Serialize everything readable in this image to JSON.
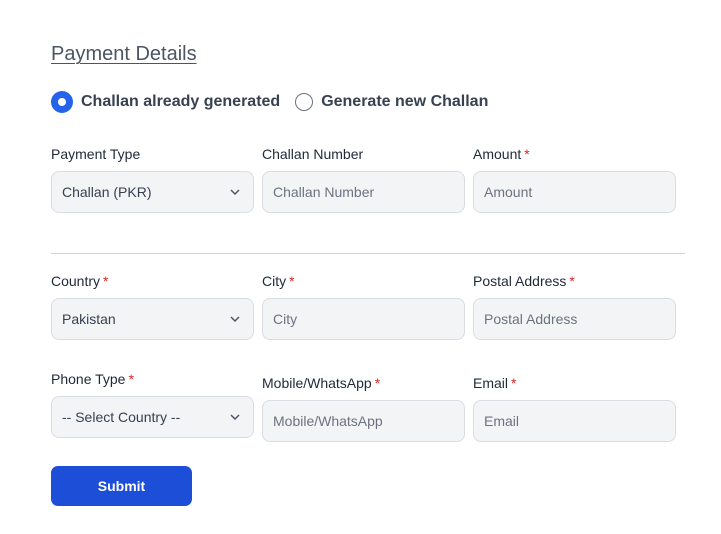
{
  "section_title": "Payment Details",
  "radios": [
    {
      "label": "Challan already generated",
      "checked": true
    },
    {
      "label": "Generate new Challan",
      "checked": false
    }
  ],
  "fields": {
    "payment_type": {
      "label": "Payment Type",
      "required": false,
      "value": "Challan (PKR)"
    },
    "challan_number": {
      "label": "Challan Number",
      "required": false,
      "placeholder": "Challan Number"
    },
    "amount": {
      "label": "Amount",
      "required": true,
      "placeholder": "Amount"
    },
    "country": {
      "label": "Country",
      "required": true,
      "value": "Pakistan"
    },
    "city": {
      "label": "City",
      "required": true,
      "placeholder": "City"
    },
    "postal_address": {
      "label": "Postal Address",
      "required": true,
      "placeholder": "Postal Address"
    },
    "phone_type": {
      "label": "Phone Type",
      "required": true,
      "value": "-- Select Country --"
    },
    "mobile": {
      "label": "Mobile/WhatsApp",
      "required": true,
      "placeholder": "Mobile/WhatsApp"
    },
    "email": {
      "label": "Email",
      "required": true,
      "placeholder": "Email"
    }
  },
  "required_marker": "*",
  "submit_label": "Submit",
  "colors": {
    "accent": "#2563eb",
    "button": "#1d4ed8",
    "required": "#dc2626"
  }
}
